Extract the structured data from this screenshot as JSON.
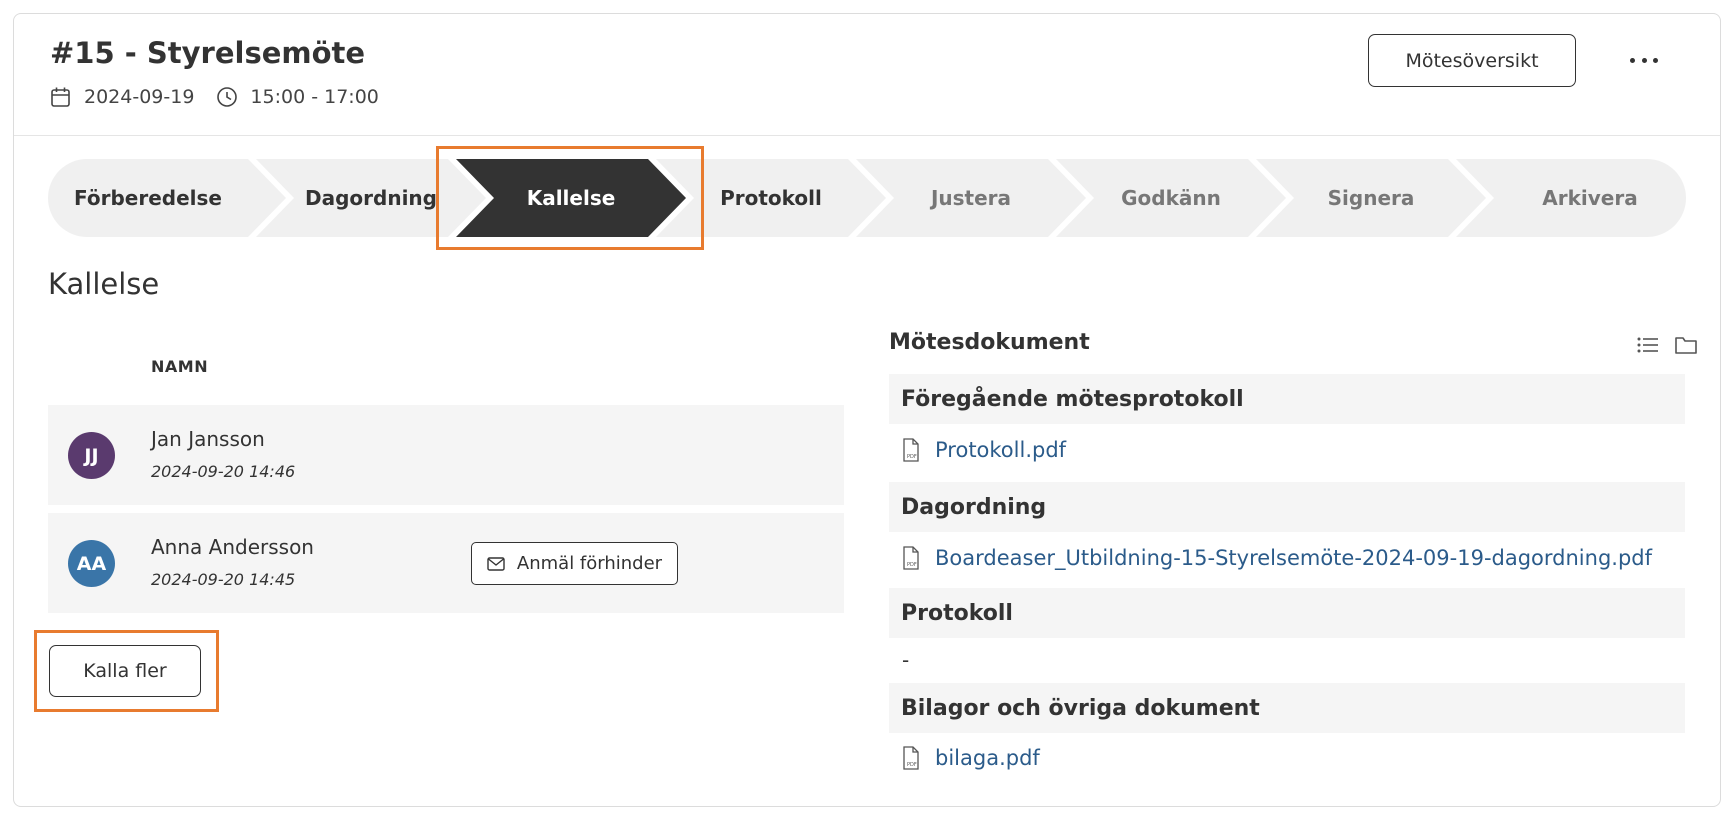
{
  "header": {
    "title": "#15 - Styrelsemöte",
    "date": "2024-09-19",
    "time": "15:00 - 17:00",
    "overview_button": "Mötesöversikt",
    "more_icon": "ellipsis-icon"
  },
  "steps": [
    {
      "label": "Förberedelse",
      "state": "done"
    },
    {
      "label": "Dagordning",
      "state": "done"
    },
    {
      "label": "Kallelse",
      "state": "active"
    },
    {
      "label": "Protokoll",
      "state": "done"
    },
    {
      "label": "Justera",
      "state": "pending"
    },
    {
      "label": "Godkänn",
      "state": "pending"
    },
    {
      "label": "Signera",
      "state": "pending"
    },
    {
      "label": "Arkivera",
      "state": "pending"
    }
  ],
  "kallelse": {
    "title": "Kallelse",
    "column_name": "NAMN",
    "people": [
      {
        "initials": "JJ",
        "name": "Jan Jansson",
        "date": "2024-09-20 14:46",
        "color": "#5a3a6e"
      },
      {
        "initials": "AA",
        "name": "Anna Andersson",
        "date": "2024-09-20 14:45",
        "color": "#3a75a8",
        "action": "Anmäl förhinder"
      }
    ],
    "call_more_button": "Kalla fler"
  },
  "documents": {
    "title": "Mötesdokument",
    "sections": [
      {
        "title": "Föregående mötesprotokoll",
        "files": [
          "Protokoll.pdf"
        ]
      },
      {
        "title": "Dagordning",
        "files": [
          "Boardeaser_Utbildning-15-Styrelsemöte-2024-09-19-dagordning.pdf"
        ]
      },
      {
        "title": "Protokoll",
        "empty": "-"
      },
      {
        "title": "Bilagor och övriga dokument",
        "files": [
          "bilaga.pdf"
        ]
      }
    ]
  },
  "colors": {
    "step_done_bg": "#f0f0f0",
    "step_active_bg": "#333333",
    "step_pending_text": "#777777",
    "highlight": "#e87b2f",
    "link": "#2b5b8a"
  }
}
